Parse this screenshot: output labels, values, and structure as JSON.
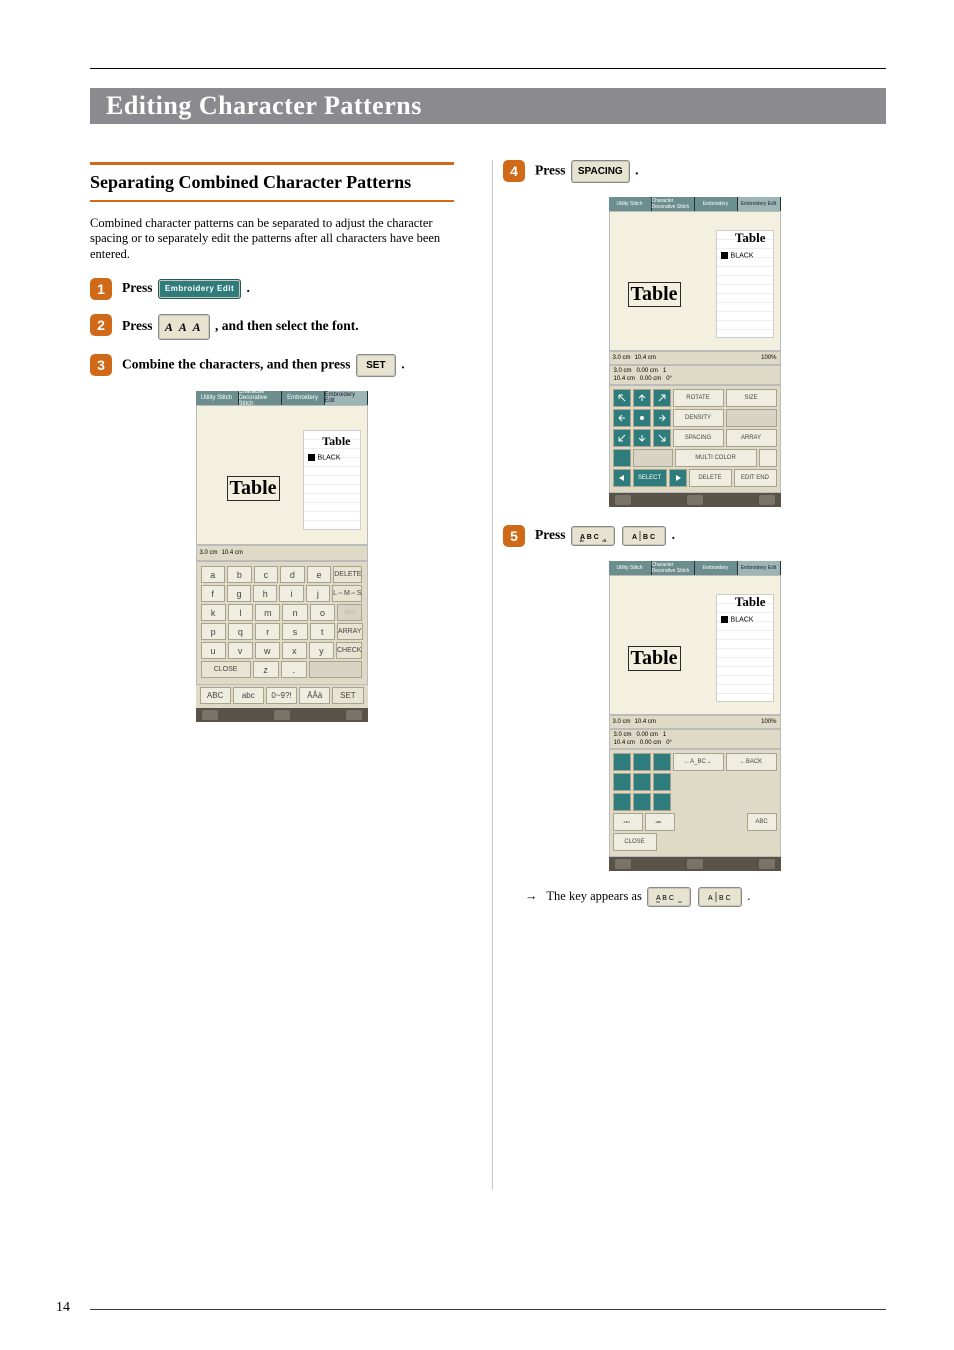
{
  "page_number": "14",
  "chapter_title": "Editing Character Patterns",
  "section_title": "Separating Combined Character Patterns",
  "intro_text": "Combined character patterns can be separated to adjust the character spacing or to separately edit the patterns after all characters have been entered.",
  "steps": {
    "s1": {
      "num": "1",
      "prefix": "Press ",
      "btn": "Embroidery\nEdit",
      "suffix": " ."
    },
    "s2": {
      "num": "2",
      "prefix": "Press ",
      "btn": "A A A",
      "suffix": " , and then select the font."
    },
    "s3": {
      "num": "3",
      "prefix": "Combine the characters, and then press ",
      "btn": "SET",
      "suffix": " ."
    },
    "s4": {
      "num": "4",
      "prefix": "Press ",
      "btn": "SPACING",
      "suffix": " ."
    },
    "s5": {
      "num": "5",
      "prefix": "Press ",
      "btn1": "A B C",
      "btn2": "A|BC",
      "suffix": " ."
    }
  },
  "result_line": {
    "arrow": "→",
    "text_before": "The key appears as ",
    "btn1": "A B C",
    "btn2": "A|BC",
    "text_after": " ."
  },
  "tabs": {
    "t1": "Utility Stitch",
    "t2": "Character Decorative Stitch",
    "t3": "Embroidery",
    "t4": "Embroidery Edit"
  },
  "shared": {
    "word": "Table",
    "black": "BLACK",
    "dim1": "3.0 cm",
    "dim2": "10.4 cm"
  },
  "shotA": {
    "keys": {
      "r1": [
        "a",
        "b",
        "c",
        "d",
        "e"
      ],
      "r1_side": "DELETE",
      "r2": [
        "f",
        "g",
        "h",
        "i",
        "j"
      ],
      "r2_side": "L⇔M⇔S",
      "r3": [
        "k",
        "l",
        "m",
        "n",
        "o"
      ],
      "r3_side": "abc",
      "r4": [
        "p",
        "q",
        "r",
        "s",
        "t"
      ],
      "r4_side": "ARRAY",
      "r5": [
        "u",
        "v",
        "w",
        "x",
        "y"
      ],
      "r5_side": "CHECK",
      "r6_close": "CLOSE",
      "r6_keys": [
        "z",
        "."
      ]
    },
    "bottom": {
      "b1": "ABC",
      "b2": "abc",
      "b3": "0~9?!",
      "b4": "ÄÅä",
      "b5": "SET"
    }
  },
  "shotB": {
    "info2": {
      "l1": "3.0 cm",
      "l2": "10.4 cm",
      "m1": "0.00 cm",
      "m2": "0.00 cm",
      "r1": "1",
      "r2": "0°",
      "pct": "100%"
    },
    "tools": {
      "rotate": "ROTATE",
      "size": "SIZE",
      "density": "DENSITY",
      "spacing": "SPACING",
      "array": "ARRAY",
      "multi": "MULTI COLOR",
      "select": "SELECT",
      "delete": "DELETE",
      "editend": "EDIT END"
    }
  },
  "shotC": {
    "tools": {
      "ea": "←A_BC→",
      "back": "←BACK",
      "abc": "ABC",
      "close": "CLOSE"
    }
  }
}
